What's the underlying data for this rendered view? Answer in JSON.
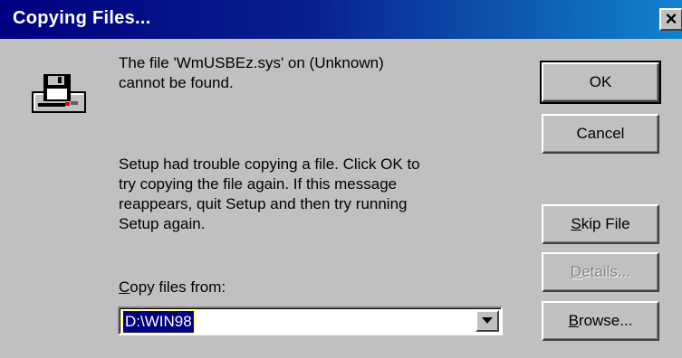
{
  "window": {
    "title": "Copying Files...",
    "close_glyph": "×"
  },
  "icon": {
    "name": "disk-drive-icon"
  },
  "message": {
    "primary": "The file 'WmUSBEz.sys' on (Unknown)\ncannot be found.",
    "secondary": "Setup had trouble copying a file. Click OK to\ntry copying the file again. If this message\nreappears, quit Setup and then try running\nSetup again."
  },
  "copy_from": {
    "label_first": "C",
    "label_rest": "opy files from:",
    "value": "D:\\WIN98"
  },
  "buttons": {
    "ok": "OK",
    "cancel": "Cancel",
    "skip_first": "S",
    "skip_rest": "kip File",
    "details_first": "D",
    "details_rest": "etails...",
    "browse_first": "B",
    "browse_rest": "rowse..."
  },
  "colors": {
    "titlebar_start": "#000080",
    "titlebar_end": "#1084d0",
    "dialog_face": "#c0c0c0",
    "selection": "#000080"
  }
}
